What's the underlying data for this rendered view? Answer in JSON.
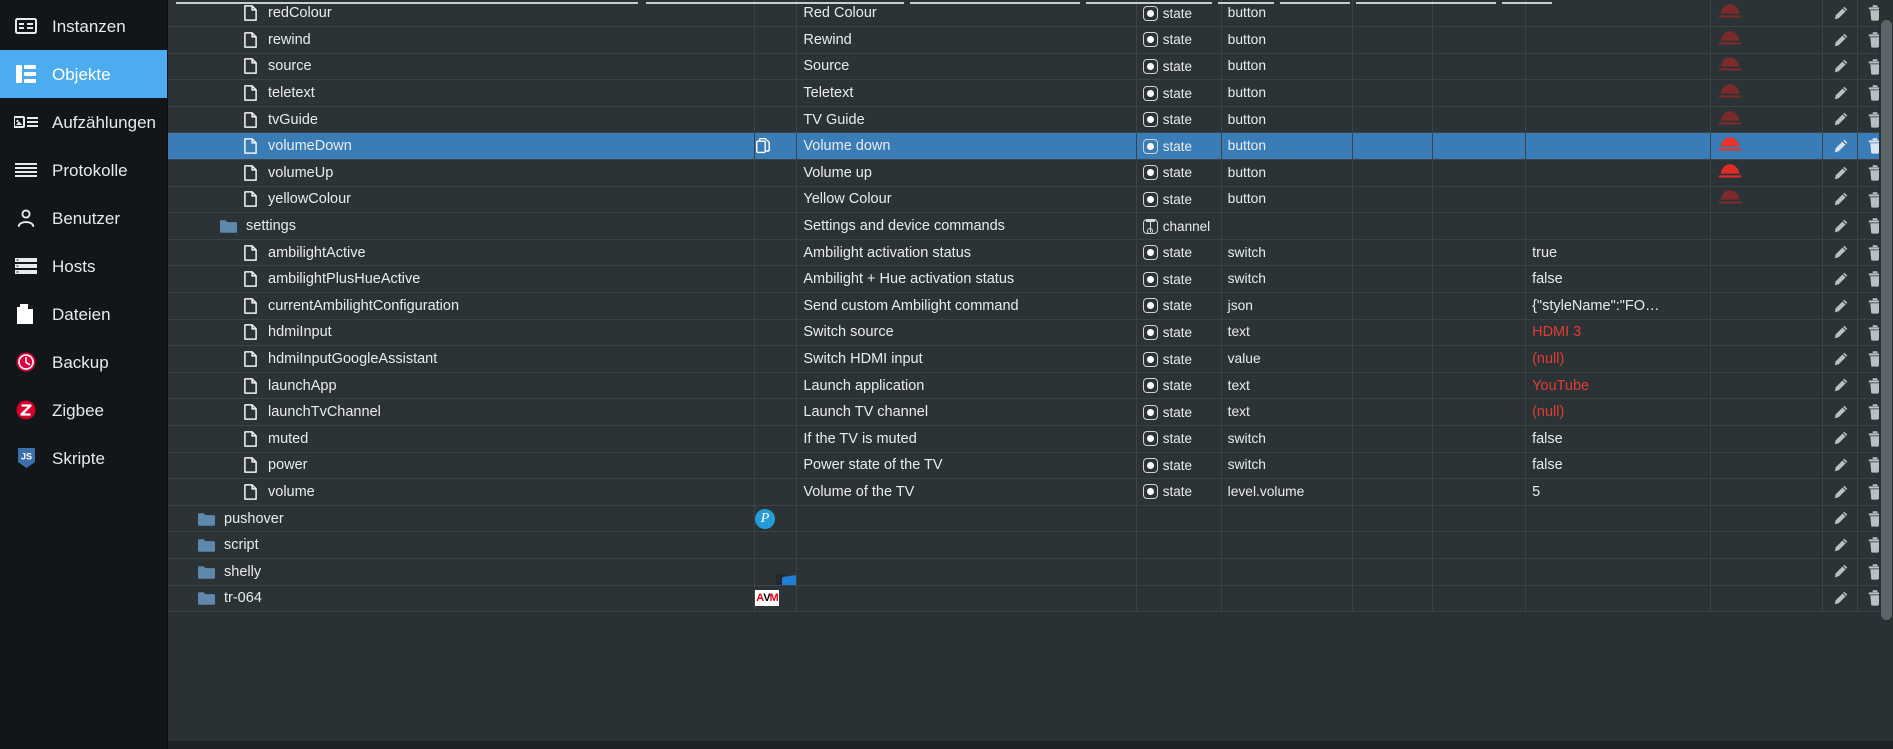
{
  "sidebar": {
    "items": [
      {
        "label": "Instanzen",
        "icon": "instances-icon",
        "active": false
      },
      {
        "label": "Objekte",
        "icon": "objects-icon",
        "active": true
      },
      {
        "label": "Aufzählungen",
        "icon": "enums-icon",
        "active": false
      },
      {
        "label": "Protokolle",
        "icon": "logs-icon",
        "active": false
      },
      {
        "label": "Benutzer",
        "icon": "user-icon",
        "active": false
      },
      {
        "label": "Hosts",
        "icon": "hosts-icon",
        "active": false
      },
      {
        "label": "Dateien",
        "icon": "files-icon",
        "active": false
      },
      {
        "label": "Backup",
        "icon": "backup-icon",
        "active": false
      },
      {
        "label": "Zigbee",
        "icon": "zigbee-icon",
        "active": false
      },
      {
        "label": "Skripte",
        "icon": "scripts-icon",
        "active": false
      }
    ]
  },
  "colors": {
    "accent": "#4dabef",
    "row_selected": "#3a7cb5",
    "background": "#2a3135",
    "sidebar": "#121619",
    "value_red": "#e33a34",
    "button_red": "#e02b26",
    "button_red_dim": "#7d2a2a"
  },
  "table": {
    "rows": [
      {
        "name": "redColour",
        "indent": 2,
        "icon": "state-file-icon",
        "description": "Red Colour",
        "role_icon": "state-icon",
        "role": "state",
        "type": "button",
        "value": "",
        "value_red": false,
        "button": "push-button-icon",
        "button_active": false,
        "copy": false,
        "selected": false,
        "adapter": ""
      },
      {
        "name": "rewind",
        "indent": 2,
        "icon": "state-file-icon",
        "description": "Rewind",
        "role_icon": "state-icon",
        "role": "state",
        "type": "button",
        "value": "",
        "value_red": false,
        "button": "push-button-icon",
        "button_active": false,
        "copy": false,
        "selected": false,
        "adapter": ""
      },
      {
        "name": "source",
        "indent": 2,
        "icon": "state-file-icon",
        "description": "Source",
        "role_icon": "state-icon",
        "role": "state",
        "type": "button",
        "value": "",
        "value_red": false,
        "button": "push-button-icon",
        "button_active": false,
        "copy": false,
        "selected": false,
        "adapter": ""
      },
      {
        "name": "teletext",
        "indent": 2,
        "icon": "state-file-icon",
        "description": "Teletext",
        "role_icon": "state-icon",
        "role": "state",
        "type": "button",
        "value": "",
        "value_red": false,
        "button": "push-button-icon",
        "button_active": false,
        "copy": false,
        "selected": false,
        "adapter": ""
      },
      {
        "name": "tvGuide",
        "indent": 2,
        "icon": "state-file-icon",
        "description": "TV Guide",
        "role_icon": "state-icon",
        "role": "state",
        "type": "button",
        "value": "",
        "value_red": false,
        "button": "push-button-icon",
        "button_active": false,
        "copy": false,
        "selected": false,
        "adapter": ""
      },
      {
        "name": "volumeDown",
        "indent": 2,
        "icon": "state-file-icon",
        "description": "Volume down",
        "role_icon": "state-icon",
        "role": "state",
        "type": "button",
        "value": "",
        "value_red": false,
        "button": "push-button-icon",
        "button_active": true,
        "copy": true,
        "selected": true,
        "adapter": ""
      },
      {
        "name": "volumeUp",
        "indent": 2,
        "icon": "state-file-icon",
        "description": "Volume up",
        "role_icon": "state-icon",
        "role": "state",
        "type": "button",
        "value": "",
        "value_red": false,
        "button": "push-button-icon",
        "button_active": true,
        "copy": false,
        "selected": false,
        "adapter": ""
      },
      {
        "name": "yellowColour",
        "indent": 2,
        "icon": "state-file-icon",
        "description": "Yellow Colour",
        "role_icon": "state-icon",
        "role": "state",
        "type": "button",
        "value": "",
        "value_red": false,
        "button": "push-button-icon",
        "button_active": false,
        "copy": false,
        "selected": false,
        "adapter": ""
      },
      {
        "name": "settings",
        "indent": 1,
        "icon": "folder-icon",
        "description": "Settings and device commands",
        "role_icon": "channel-icon",
        "role": "channel",
        "type": "",
        "value": "",
        "value_red": false,
        "button": "",
        "button_active": false,
        "copy": false,
        "selected": false,
        "adapter": ""
      },
      {
        "name": "ambilightActive",
        "indent": 2,
        "icon": "state-file-icon",
        "description": "Ambilight activation status",
        "role_icon": "state-icon",
        "role": "state",
        "type": "switch",
        "value": "true",
        "value_red": false,
        "button": "",
        "button_active": false,
        "copy": false,
        "selected": false,
        "adapter": ""
      },
      {
        "name": "ambilightPlusHueActive",
        "indent": 2,
        "icon": "state-file-icon",
        "description": "Ambilight + Hue activation status",
        "role_icon": "state-icon",
        "role": "state",
        "type": "switch",
        "value": "false",
        "value_red": false,
        "button": "",
        "button_active": false,
        "copy": false,
        "selected": false,
        "adapter": ""
      },
      {
        "name": "currentAmbilightConfiguration",
        "indent": 2,
        "icon": "state-file-icon",
        "description": "Send custom Ambilight command",
        "role_icon": "state-icon",
        "role": "state",
        "type": "json",
        "value": "{\"styleName\":\"FO…",
        "value_red": false,
        "button": "",
        "button_active": false,
        "copy": false,
        "selected": false,
        "adapter": ""
      },
      {
        "name": "hdmiInput",
        "indent": 2,
        "icon": "state-file-icon",
        "description": "Switch source",
        "role_icon": "state-icon",
        "role": "state",
        "type": "text",
        "value": "HDMI 3",
        "value_red": true,
        "button": "",
        "button_active": false,
        "copy": false,
        "selected": false,
        "adapter": ""
      },
      {
        "name": "hdmiInputGoogleAssistant",
        "indent": 2,
        "icon": "state-file-icon",
        "description": "Switch HDMI input",
        "role_icon": "state-icon",
        "role": "state",
        "type": "value",
        "value": "(null)",
        "value_red": true,
        "button": "",
        "button_active": false,
        "copy": false,
        "selected": false,
        "adapter": ""
      },
      {
        "name": "launchApp",
        "indent": 2,
        "icon": "state-file-icon",
        "description": "Launch application",
        "role_icon": "state-icon",
        "role": "state",
        "type": "text",
        "value": "YouTube",
        "value_red": true,
        "button": "",
        "button_active": false,
        "copy": false,
        "selected": false,
        "adapter": ""
      },
      {
        "name": "launchTvChannel",
        "indent": 2,
        "icon": "state-file-icon",
        "description": "Launch TV channel",
        "role_icon": "state-icon",
        "role": "state",
        "type": "text",
        "value": "(null)",
        "value_red": true,
        "button": "",
        "button_active": false,
        "copy": false,
        "selected": false,
        "adapter": ""
      },
      {
        "name": "muted",
        "indent": 2,
        "icon": "state-file-icon",
        "description": "If the TV is muted",
        "role_icon": "state-icon",
        "role": "state",
        "type": "switch",
        "value": "false",
        "value_red": false,
        "button": "",
        "button_active": false,
        "copy": false,
        "selected": false,
        "adapter": ""
      },
      {
        "name": "power",
        "indent": 2,
        "icon": "state-file-icon",
        "description": "Power state of the TV",
        "role_icon": "state-icon",
        "role": "state",
        "type": "switch",
        "value": "false",
        "value_red": false,
        "button": "",
        "button_active": false,
        "copy": false,
        "selected": false,
        "adapter": ""
      },
      {
        "name": "volume",
        "indent": 2,
        "icon": "state-file-icon",
        "description": "Volume of the TV",
        "role_icon": "state-icon",
        "role": "state",
        "type": "level.volume",
        "value": "5",
        "value_red": false,
        "button": "",
        "button_active": false,
        "copy": false,
        "selected": false,
        "adapter": ""
      },
      {
        "name": "pushover",
        "indent": 0,
        "icon": "folder-icon",
        "description": "",
        "role_icon": "",
        "role": "",
        "type": "",
        "value": "",
        "value_red": false,
        "button": "",
        "button_active": false,
        "copy": false,
        "selected": false,
        "adapter": "pushover-adapter-icon"
      },
      {
        "name": "script",
        "indent": 0,
        "icon": "folder-icon",
        "description": "",
        "role_icon": "",
        "role": "",
        "type": "",
        "value": "",
        "value_red": false,
        "button": "",
        "button_active": false,
        "copy": false,
        "selected": false,
        "adapter": ""
      },
      {
        "name": "shelly",
        "indent": 0,
        "icon": "folder-icon",
        "description": "",
        "role_icon": "",
        "role": "",
        "type": "",
        "value": "",
        "value_red": false,
        "button": "",
        "button_active": false,
        "copy": false,
        "selected": false,
        "adapter": "shelly-adapter-icon"
      },
      {
        "name": "tr-064",
        "indent": 0,
        "icon": "folder-icon",
        "description": "",
        "role_icon": "",
        "role": "",
        "type": "",
        "value": "",
        "value_red": false,
        "button": "",
        "button_active": false,
        "copy": false,
        "selected": false,
        "adapter": "avm-adapter-icon"
      }
    ]
  }
}
